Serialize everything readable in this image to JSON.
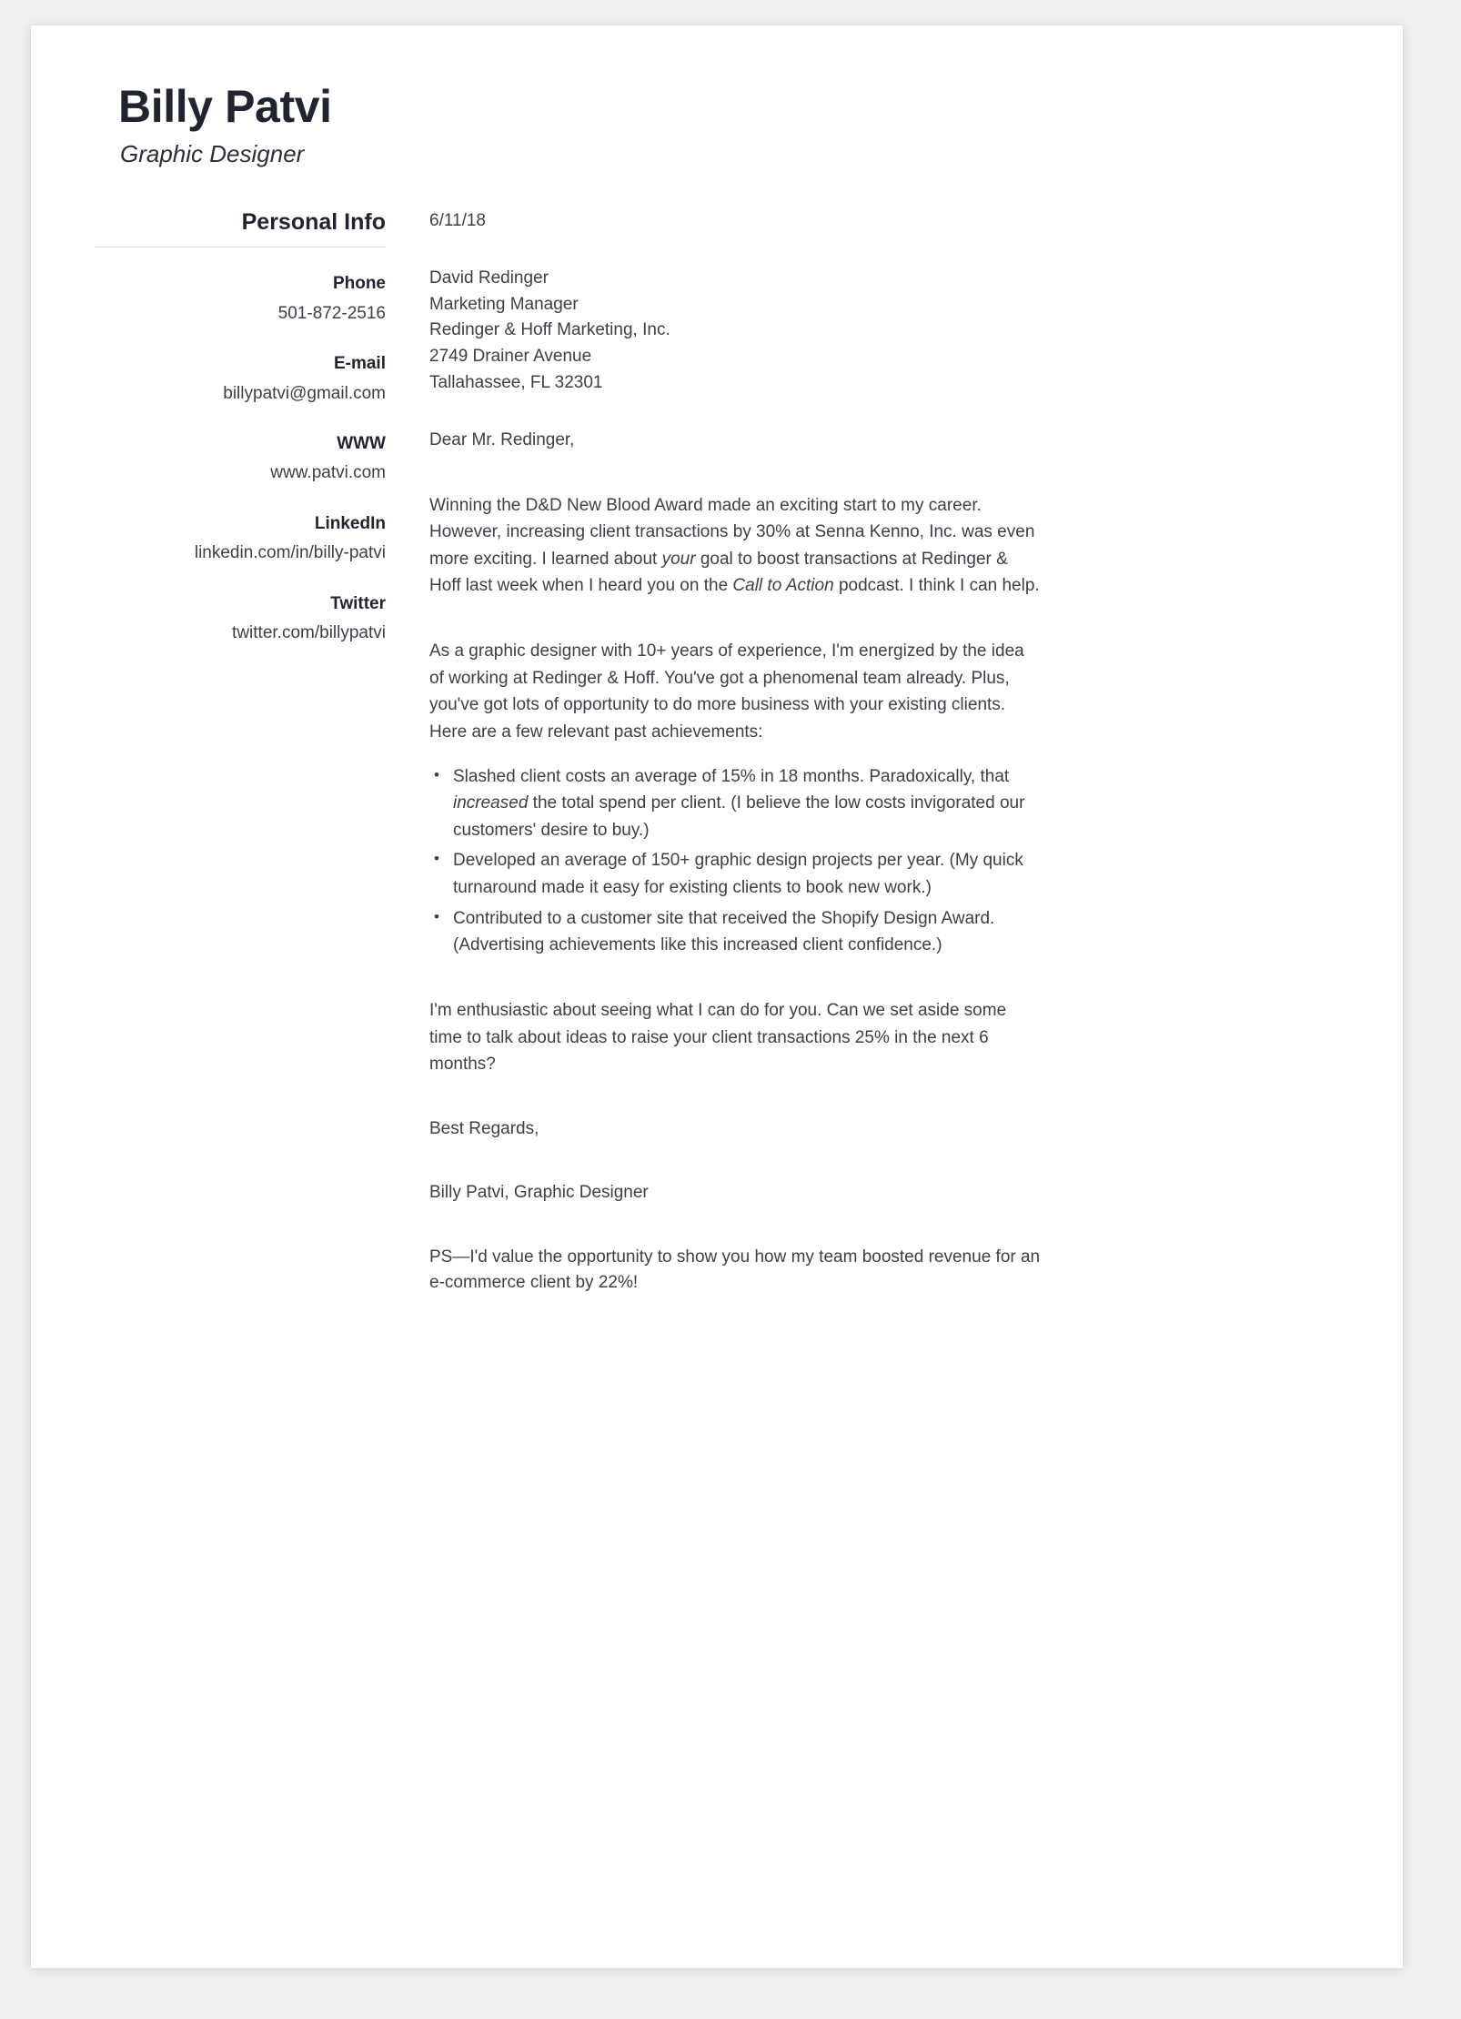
{
  "header": {
    "name": "Billy Patvi",
    "job_title": "Graphic Designer"
  },
  "sidebar": {
    "heading": "Personal Info",
    "items": [
      {
        "label": "Phone",
        "value": "501-872-2516"
      },
      {
        "label": "E-mail",
        "value": "billypatvi@gmail.com"
      },
      {
        "label": "WWW",
        "value": "www.patvi.com"
      },
      {
        "label": "LinkedIn",
        "value": "linkedin.com/in/billy-patvi"
      },
      {
        "label": "Twitter",
        "value": "twitter.com/billypatvi"
      }
    ]
  },
  "letter": {
    "date": "6/11/18",
    "recipient": {
      "name": "David Redinger",
      "title": "Marketing Manager",
      "company": "Redinger & Hoff Marketing, Inc.",
      "street": "2749 Drainer Avenue",
      "city_state_zip": "Tallahassee, FL 32301"
    },
    "salutation": "Dear Mr. Redinger,",
    "paragraph_1": {
      "part_1": "Winning the D&D New Blood Award made an exciting start to my career. However, increasing client transactions by 30% at Senna Kenno, Inc. was even more exciting. I learned about ",
      "italic_1": "your",
      "part_2": " goal to boost transactions at Redinger & Hoff last week when I heard you on the ",
      "italic_2": "Call to Action",
      "part_3": " podcast. I think I can help."
    },
    "paragraph_2": "As a graphic designer with 10+ years of experience, I'm energized by the idea of working at Redinger & Hoff. You've got a phenomenal team already. Plus, you've got lots of opportunity to do more business with your existing clients. Here are a few relevant past achievements:",
    "achievements": [
      {
        "part_1": "Slashed client costs an average of 15% in 18 months. Paradoxically, that ",
        "italic_1": "increased",
        "part_2": " the total spend per client. (I believe the low costs invigorated our customers' desire to buy.)"
      },
      {
        "part_1": "Developed an average of 150+ graphic design projects per year. (My quick turnaround made it easy for existing clients to book new work.)",
        "italic_1": "",
        "part_2": ""
      },
      {
        "part_1": "Contributed to a customer site that received the Shopify Design Award. (Advertising achievements like this increased client confidence.)",
        "italic_1": "",
        "part_2": ""
      }
    ],
    "paragraph_3": "I'm enthusiastic about seeing what I can do for you. Can we set aside some time to talk about ideas to raise your client transactions 25% in the next 6 months?",
    "closing": "Best Regards,",
    "signature": "Billy Patvi, Graphic Designer",
    "postscript": "PS—I'd value the opportunity to show you how my team boosted revenue for an e-commerce client by 22%!"
  },
  "colors": {
    "page_background": "#f1f1f0",
    "paper": "#ffffff",
    "heading_text": "#1f2430",
    "body_text": "#3b3f46",
    "rule": "#d8d8d8"
  }
}
